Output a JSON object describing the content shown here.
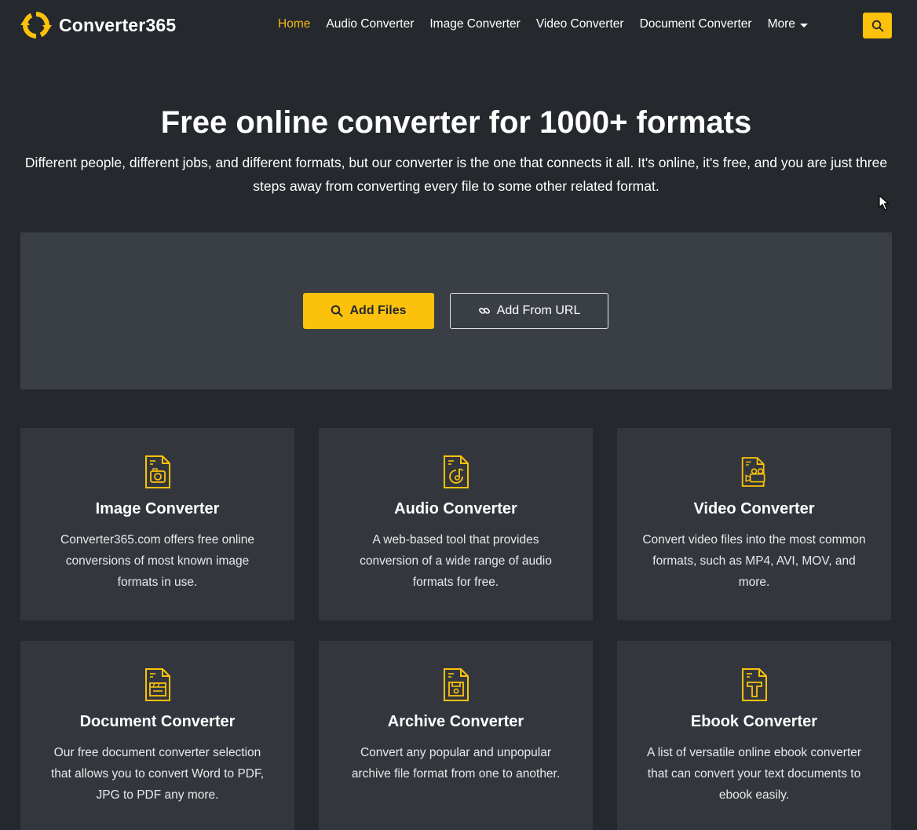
{
  "brand": {
    "name": "Converter365"
  },
  "nav": {
    "items": [
      {
        "label": "Home",
        "active": true
      },
      {
        "label": "Audio Converter",
        "active": false
      },
      {
        "label": "Image Converter",
        "active": false
      },
      {
        "label": "Video Converter",
        "active": false
      },
      {
        "label": "Document Converter",
        "active": false
      }
    ],
    "more_label": "More",
    "search_icon": "search-icon"
  },
  "hero": {
    "title": "Free online converter for 1000+ formats",
    "subtitle": "Different people, different jobs, and different formats, but our converter is the one that connects it all. It's online, it's free, and you are just three steps away from converting every file to some other related format."
  },
  "upload": {
    "add_files_label": "Add Files",
    "add_url_label": "Add From URL"
  },
  "cards": [
    {
      "title": "Image Converter",
      "desc": "Converter365.com offers free online conversions of most known image formats in use.",
      "icon": "image-file-icon"
    },
    {
      "title": "Audio Converter",
      "desc": "A web-based tool that provides conversion of a wide range of audio formats for free.",
      "icon": "audio-file-icon"
    },
    {
      "title": "Video Converter",
      "desc": "Convert video files into the most common formats, such as MP4, AVI, MOV, and more.",
      "icon": "video-file-icon"
    },
    {
      "title": "Document Converter",
      "desc": "Our free document converter selection that allows you to convert Word to PDF, JPG to PDF any more.",
      "icon": "document-file-icon"
    },
    {
      "title": "Archive Converter",
      "desc": "Convert any popular and unpopular archive file format from one to another.",
      "icon": "archive-file-icon"
    },
    {
      "title": "Ebook Converter",
      "desc": "A list of versatile online ebook converter that can convert your text documents to ebook easily.",
      "icon": "ebook-file-icon"
    }
  ],
  "colors": {
    "background": "#25282d",
    "panel": "#3a3f46",
    "card": "#33373d",
    "accent": "#fcc10b"
  }
}
